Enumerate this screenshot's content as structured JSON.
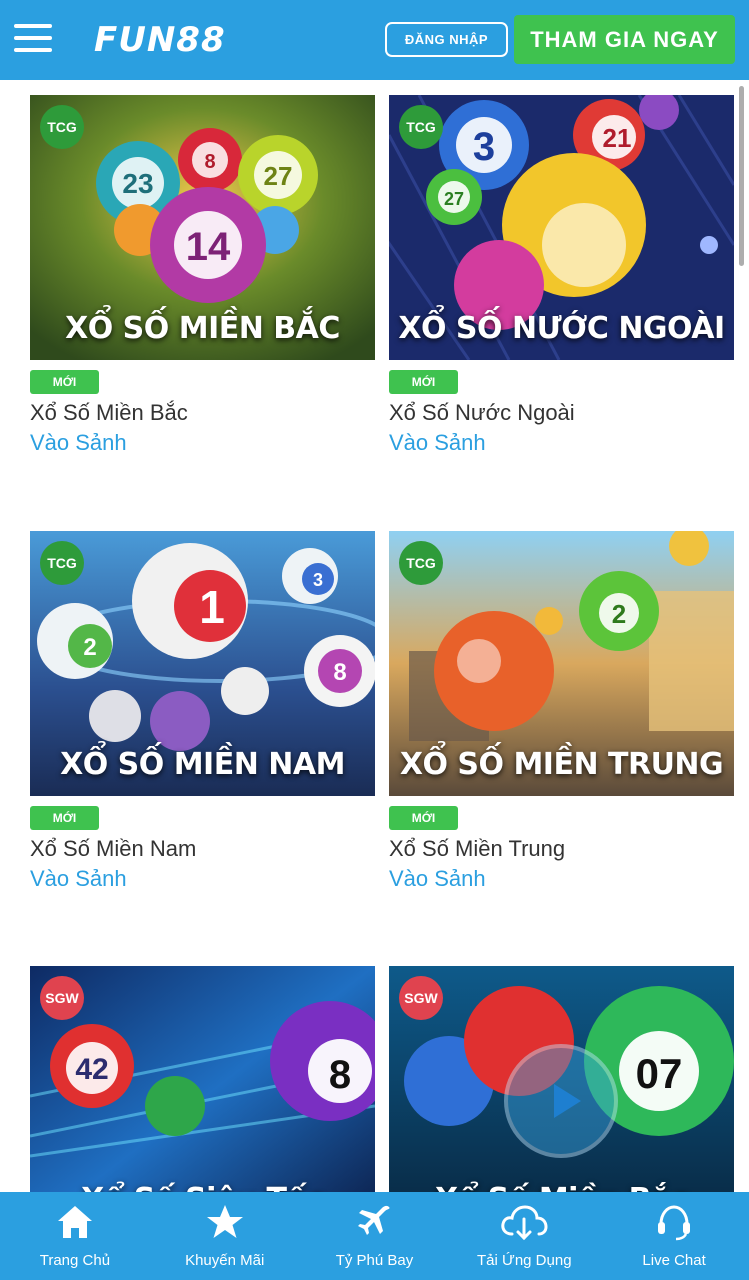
{
  "header": {
    "logo": "FUN88",
    "login_label": "ĐĂNG NHẬP",
    "join_label": "THAM GIA NGAY"
  },
  "games": [
    {
      "provider": "TCG",
      "banner": "XỔ SỐ MIỀN BẮC",
      "badge": "MỚI",
      "name": "Xổ Số Miền Bắc",
      "link": "Vào Sảnh"
    },
    {
      "provider": "TCG",
      "banner": "XỔ SỐ NƯỚC NGOÀI",
      "badge": "MỚI",
      "name": "Xổ Số Nước Ngoài",
      "link": "Vào Sảnh"
    },
    {
      "provider": "TCG",
      "banner": "XỔ SỐ MIỀN NAM",
      "badge": "MỚI",
      "name": "Xổ Số Miền Nam",
      "link": "Vào Sảnh"
    },
    {
      "provider": "TCG",
      "banner": "XỔ SỐ MIỀN TRUNG",
      "badge": "MỚI",
      "name": "Xổ Số Miền Trung",
      "link": "Vào Sảnh"
    },
    {
      "provider": "SGW",
      "banner": "Xổ Số Siêu Tốc"
    },
    {
      "provider": "SGW",
      "banner": "Xổ Số Miền Bắc"
    }
  ],
  "ball_numbers": {
    "g0": [
      "23",
      "8",
      "27",
      "14"
    ],
    "g1": [
      "3",
      "21",
      "27"
    ],
    "g2": [
      "1",
      "3",
      "2",
      "8"
    ],
    "g3": [
      "2"
    ],
    "g4": [
      "42",
      "8"
    ],
    "g5": [
      "07"
    ]
  },
  "bottom_nav": [
    {
      "label": "Trang Chủ",
      "icon": "home-icon"
    },
    {
      "label": "Khuyến Mãi",
      "icon": "star-icon"
    },
    {
      "label": "Tỷ Phú Bay",
      "icon": "plane-icon"
    },
    {
      "label": "Tải Ứng Dụng",
      "icon": "cloud-download-icon"
    },
    {
      "label": "Live Chat",
      "icon": "headset-icon"
    }
  ],
  "colors": {
    "brand": "#2b9fe0",
    "join": "#3fc24f",
    "tcg_badge": "#2e9b3a",
    "sgw_badge": "#e0434f"
  }
}
